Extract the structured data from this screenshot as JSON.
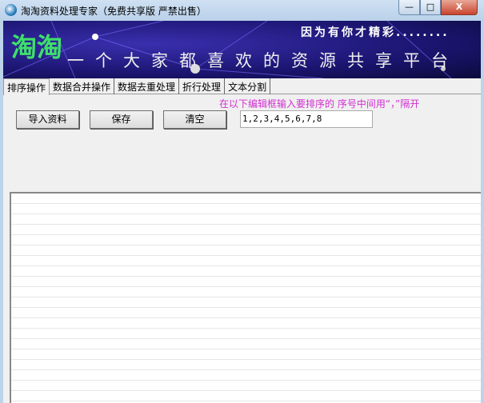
{
  "window": {
    "title": "淘淘资料处理专家（免费共享版 严禁出售）",
    "min": "—",
    "max": "□",
    "close": "X"
  },
  "banner": {
    "logo": "淘淘",
    "tagline_top": "因为有你才精彩........",
    "tagline": "一个大家都喜欢的资源共享平台"
  },
  "tabs": [
    {
      "label": "排序操作"
    },
    {
      "label": "数据合并操作"
    },
    {
      "label": "数据去重处理"
    },
    {
      "label": "折行处理"
    },
    {
      "label": "文本分割"
    }
  ],
  "sort": {
    "hint": "在以下编辑框输入要排序的 序号中间用“，”隔开",
    "import_label": "导入资料",
    "save_label": "保存",
    "clear_label": "清空",
    "order_value": "1,2,3,4,5,6,7,8"
  }
}
